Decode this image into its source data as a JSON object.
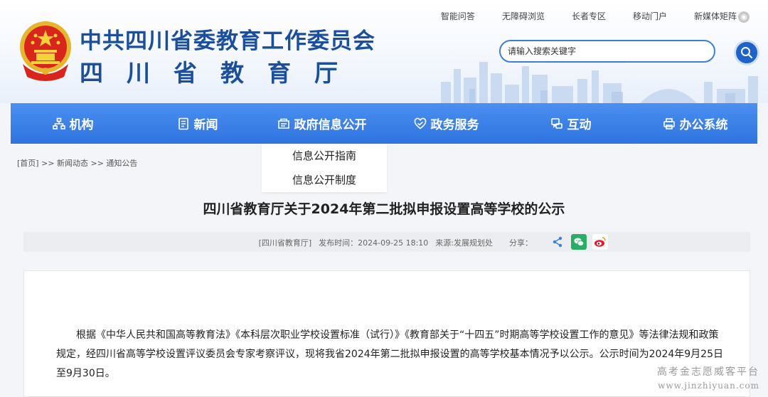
{
  "header": {
    "title_line1": "中共四川省委教育工作委员会",
    "title_line2": "四川省教育厅",
    "top_links": [
      "智能问答",
      "无障碍浏览",
      "长者专区",
      "移动门户",
      "新媒体矩阵"
    ],
    "search": {
      "placeholder": "请输入搜索关键字"
    }
  },
  "nav": {
    "items": [
      {
        "label": "机构",
        "icon": "org-chart-icon"
      },
      {
        "label": "新闻",
        "icon": "news-doc-icon"
      },
      {
        "label": "政府信息公开",
        "icon": "info-open-icon"
      },
      {
        "label": "政务服务",
        "icon": "heart-service-icon"
      },
      {
        "label": "互动",
        "icon": "interact-icon"
      },
      {
        "label": "办公系统",
        "icon": "office-printer-icon"
      }
    ],
    "dropdown": [
      "信息公开指南",
      "信息公开制度"
    ]
  },
  "breadcrumb": "[首页] >> 新闻动态 >> 通知公告",
  "article": {
    "title": "四川省教育厅关于2024年第二批拟申报设置高等学校的公示",
    "source_tag": "[四川省教育厅]",
    "publish_time": "发布时间：2024-09-25 18:10",
    "origin": "来源:发展规划处",
    "share_label": "分享：",
    "body": "根据《中华人民共和国高等教育法》《本科层次职业学校设置标准（试行）》《教育部关于“十四五”时期高等学校设置工作的意见》等法律法规和政策规定，经四川省高等学校设置评议委员会专家考察评议，现将我省2024年第二批拟申报设置的高等学校基本情况予以公示。公示时间为2024年9月25日至9月30日。"
  },
  "watermark": {
    "line1": "高考金志愿威客平台",
    "line2": "www.jinzhiyuan.com"
  },
  "colors": {
    "brand_blue": "#1b4f9c",
    "nav_blue": "#3a80e8",
    "wechat_green": "#2aae67",
    "weibo_red": "#e6162d"
  }
}
